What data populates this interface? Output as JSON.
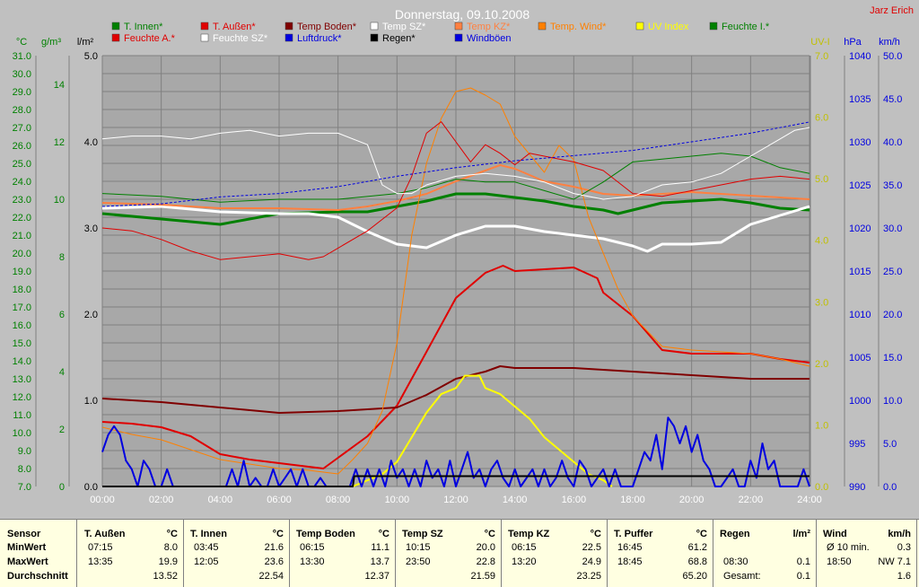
{
  "title": "Donnerstag, 09.10.2008",
  "author": "Jarz Erich",
  "colors": {
    "bg": "#c0c0c0",
    "plot": "#a8a8a8",
    "grid": "#808080",
    "green": "#008000",
    "red": "#e00000",
    "darkred": "#800000",
    "white": "#ffffff",
    "orange": "#ff8040",
    "yellow": "#ffff00",
    "blue": "#0000e0",
    "black": "#000000",
    "panel": "#ffffe1"
  },
  "axis_units": {
    "temp": "°C",
    "hum": "g/m³",
    "rain": "l/m²",
    "uv": "UV-I",
    "press": "hPa",
    "wind": "km/h"
  },
  "chart_data": {
    "type": "line",
    "title": "Donnerstag, 09.10.2008",
    "x_ticks": [
      "00:00",
      "02:00",
      "04:00",
      "06:00",
      "08:00",
      "10:00",
      "12:00",
      "14:00",
      "16:00",
      "18:00",
      "20:00",
      "22:00",
      "24:00"
    ],
    "x_range": [
      0,
      24
    ],
    "axes": {
      "temp": {
        "label": "°C",
        "range": [
          7,
          31
        ],
        "ticks": [
          "7.0",
          "8.0",
          "9.0",
          "10.0",
          "11.0",
          "12.0",
          "13.0",
          "14.0",
          "15.0",
          "16.0",
          "17.0",
          "18.0",
          "19.0",
          "20.0",
          "21.0",
          "22.0",
          "23.0",
          "24.0",
          "25.0",
          "26.0",
          "27.0",
          "28.0",
          "29.0",
          "30.0",
          "31.0"
        ]
      },
      "hum": {
        "label": "g/m³",
        "range": [
          0,
          15
        ],
        "ticks": [
          "0",
          "2",
          "4",
          "6",
          "8",
          "10",
          "12",
          "14"
        ]
      },
      "rain": {
        "label": "l/m²",
        "range": [
          0,
          5
        ],
        "ticks": [
          "0.0",
          "1.0",
          "2.0",
          "3.0",
          "4.0",
          "5.0"
        ]
      },
      "uv": {
        "label": "UV-I",
        "range": [
          0,
          7
        ],
        "ticks": [
          "0.0",
          "1.0",
          "2.0",
          "3.0",
          "4.0",
          "5.0",
          "6.0",
          "7.0"
        ]
      },
      "press": {
        "label": "hPa",
        "range": [
          990,
          1040
        ],
        "ticks": [
          "990",
          "995",
          "1000",
          "1005",
          "1010",
          "1015",
          "1020",
          "1025",
          "1030",
          "1035",
          "1040"
        ]
      },
      "wind": {
        "label": "km/h",
        "range": [
          0,
          50
        ],
        "ticks": [
          "0.0",
          "5.0",
          "10.0",
          "15.0",
          "20.0",
          "25.0",
          "30.0",
          "35.0",
          "40.0",
          "45.0",
          "50.0"
        ]
      }
    },
    "legend": [
      {
        "label": "T. Innen*",
        "color": "#008000"
      },
      {
        "label": "T. Außen*",
        "color": "#e00000"
      },
      {
        "label": "Temp Boden*",
        "color": "#800000"
      },
      {
        "label": "Temp SZ*",
        "color": "#ffffff"
      },
      {
        "label": "Temp KZ*",
        "color": "#ff8040"
      },
      {
        "label": "Temp. Wind*",
        "color": "#ff8000"
      },
      {
        "label": "UV Index",
        "color": "#ffff00"
      },
      {
        "label": "Feuchte I.*",
        "color": "#008000"
      },
      {
        "label": "Feuchte A.*",
        "color": "#e00000"
      },
      {
        "label": "Feuchte SZ*",
        "color": "#ffffff"
      },
      {
        "label": "Luftdruck*",
        "color": "#0000e0"
      },
      {
        "label": "Regen*",
        "color": "#000000"
      },
      {
        "label": "Windböen",
        "color": "#0000e0"
      }
    ],
    "series": [
      {
        "name": "T. Innen*",
        "axis": "temp",
        "color": "#008000",
        "width": 3,
        "x": [
          0,
          2,
          4,
          6,
          8,
          9,
          10,
          11,
          12,
          13,
          14,
          15,
          16,
          17,
          17.5,
          18,
          19,
          20,
          21,
          22,
          23,
          24
        ],
        "y": [
          22.2,
          21.9,
          21.6,
          22.2,
          22.3,
          22.3,
          22.6,
          22.9,
          23.3,
          23.3,
          23.1,
          22.9,
          22.6,
          22.4,
          22.2,
          22.4,
          22.8,
          22.9,
          23.0,
          22.8,
          22.5,
          22.4
        ]
      },
      {
        "name": "T. Außen*",
        "axis": "temp",
        "color": "#e00000",
        "width": 2,
        "x": [
          0,
          1,
          2,
          3,
          4,
          5,
          6,
          7,
          7.5,
          8,
          9,
          10,
          11,
          12,
          13,
          13.6,
          14,
          15,
          16,
          16.8,
          17,
          18,
          19,
          20,
          21,
          22,
          23,
          24
        ],
        "y": [
          10.6,
          10.5,
          10.3,
          9.8,
          8.8,
          8.5,
          8.3,
          8.1,
          8.0,
          8.6,
          9.8,
          11.5,
          14.5,
          17.5,
          18.9,
          19.3,
          19.0,
          19.1,
          19.2,
          18.6,
          17.8,
          16.5,
          14.6,
          14.4,
          14.4,
          14.4,
          14.1,
          13.9
        ]
      },
      {
        "name": "Temp Boden*",
        "axis": "temp",
        "color": "#800000",
        "width": 2,
        "x": [
          0,
          2,
          4,
          6,
          8,
          10,
          11,
          12,
          13,
          13.5,
          14,
          16,
          18,
          20,
          22,
          24
        ],
        "y": [
          11.9,
          11.7,
          11.4,
          11.1,
          11.2,
          11.4,
          12.1,
          13.0,
          13.4,
          13.7,
          13.6,
          13.6,
          13.4,
          13.2,
          13.0,
          13.0
        ]
      },
      {
        "name": "Temp SZ*",
        "axis": "temp",
        "color": "#ffffff",
        "width": 3,
        "x": [
          0,
          2,
          4,
          6,
          7,
          8,
          9,
          10,
          11,
          12,
          13,
          14,
          15,
          16,
          17,
          18,
          18.5,
          19,
          20,
          21,
          22,
          23,
          24
        ],
        "y": [
          22.5,
          22.6,
          22.3,
          22.2,
          22.2,
          22.0,
          21.2,
          20.5,
          20.3,
          21.0,
          21.5,
          21.5,
          21.2,
          21.0,
          20.8,
          20.4,
          20.1,
          20.5,
          20.5,
          20.6,
          21.6,
          22.1,
          22.6
        ]
      },
      {
        "name": "Temp KZ*",
        "axis": "temp",
        "color": "#ff8040",
        "width": 2,
        "x": [
          0,
          2,
          4,
          6,
          8,
          9,
          10,
          11,
          12,
          13,
          13.5,
          14,
          15,
          16,
          17,
          18,
          19,
          20,
          21,
          22,
          23,
          24
        ],
        "y": [
          22.8,
          22.7,
          22.5,
          22.5,
          22.4,
          22.6,
          22.9,
          23.3,
          24.0,
          24.6,
          24.9,
          24.7,
          24.0,
          23.7,
          23.3,
          23.2,
          23.3,
          23.4,
          23.3,
          23.2,
          23.1,
          23.0
        ]
      },
      {
        "name": "Temp. Wind*",
        "axis": "temp",
        "color": "#ff8000",
        "width": 1,
        "x": [
          0,
          1,
          2,
          4,
          6,
          7,
          8,
          8.5,
          9,
          9.5,
          10,
          10.5,
          11,
          11.5,
          12,
          12.5,
          13,
          13.5,
          14,
          14.5,
          15,
          15.5,
          16,
          16.5,
          17,
          17.5,
          18,
          19,
          20,
          21,
          22,
          23,
          24
        ],
        "y": [
          10.3,
          9.9,
          9.6,
          8.5,
          8.0,
          7.9,
          7.7,
          8.5,
          9.4,
          11.2,
          15.0,
          21.0,
          25.0,
          27.5,
          29.0,
          29.2,
          28.8,
          28.3,
          26.5,
          25.5,
          24.5,
          26.0,
          25.2,
          22.0,
          20.0,
          18.0,
          16.5,
          14.8,
          14.6,
          14.5,
          14.4,
          14.1,
          13.7
        ]
      },
      {
        "name": "Feuchte I.*",
        "axis": "hum",
        "color": "#008000",
        "width": 1,
        "x": [
          0,
          2,
          4,
          6,
          8,
          10,
          11,
          12,
          13,
          14,
          15,
          16,
          17,
          18,
          19,
          20,
          21,
          22,
          23,
          24
        ],
        "y": [
          10.2,
          10.1,
          9.9,
          10.0,
          10.0,
          10.2,
          10.4,
          10.7,
          10.6,
          10.6,
          10.3,
          10.0,
          10.6,
          11.3,
          11.4,
          11.5,
          11.6,
          11.5,
          11.1,
          10.9
        ]
      },
      {
        "name": "Feuchte A.*",
        "axis": "hum",
        "color": "#e00000",
        "width": 1,
        "x": [
          0,
          1,
          2,
          3,
          4,
          5,
          6,
          7,
          7.5,
          8,
          9,
          10,
          10.5,
          11,
          11.5,
          12,
          12.5,
          13,
          13.5,
          14,
          14.5,
          15,
          16,
          17,
          18,
          19,
          20,
          21,
          22,
          23,
          24
        ],
        "y": [
          9.0,
          8.9,
          8.6,
          8.2,
          7.9,
          8.0,
          8.1,
          7.9,
          8.0,
          8.3,
          8.9,
          9.7,
          10.8,
          12.3,
          12.7,
          12.0,
          11.3,
          11.9,
          11.6,
          11.2,
          11.6,
          11.5,
          11.3,
          11.0,
          10.2,
          10.1,
          10.3,
          10.5,
          10.7,
          10.8,
          10.7
        ]
      },
      {
        "name": "Feuchte SZ*",
        "axis": "hum",
        "color": "#ffffff",
        "width": 1,
        "x": [
          0,
          1,
          2,
          3,
          4,
          5,
          6,
          7,
          8,
          9,
          9.5,
          10,
          10.5,
          11,
          12,
          13,
          14,
          15,
          16,
          17,
          18,
          19,
          20,
          21,
          22,
          23,
          23.5,
          24
        ],
        "y": [
          12.1,
          12.2,
          12.2,
          12.1,
          12.3,
          12.4,
          12.2,
          12.3,
          12.3,
          11.9,
          10.5,
          10.2,
          10.2,
          10.5,
          10.8,
          10.9,
          10.8,
          10.6,
          10.2,
          10.0,
          10.1,
          10.5,
          10.6,
          10.9,
          11.5,
          12.1,
          12.4,
          12.5
        ]
      },
      {
        "name": "Luftdruck*",
        "axis": "press",
        "color": "#0000e0",
        "width": 1,
        "dash": true,
        "x": [
          0,
          2,
          4,
          6,
          8,
          10,
          12,
          14,
          16,
          18,
          20,
          22,
          24
        ],
        "y": [
          1022.5,
          1022.8,
          1023.6,
          1024.0,
          1024.8,
          1026.0,
          1027.0,
          1027.8,
          1028.4,
          1029.0,
          1030.0,
          1031.0,
          1032.3
        ]
      },
      {
        "name": "UV Index",
        "axis": "uv",
        "color": "#ffff00",
        "width": 2,
        "x": [
          8.5,
          9,
          9.5,
          10,
          10.5,
          11,
          11.5,
          12,
          12.3,
          12.5,
          12.8,
          13,
          13.5,
          14,
          14.5,
          15,
          15.5,
          16,
          16.5,
          17,
          17.3
        ],
        "y": [
          0.0,
          0.1,
          0.2,
          0.4,
          0.8,
          1.2,
          1.5,
          1.6,
          1.8,
          1.8,
          1.8,
          1.6,
          1.5,
          1.3,
          1.1,
          0.8,
          0.6,
          0.4,
          0.2,
          0.1,
          0.0
        ]
      },
      {
        "name": "Windböen",
        "axis": "wind",
        "color": "#0000e0",
        "width": 2,
        "x": [
          0,
          0.2,
          0.4,
          0.6,
          0.8,
          1.0,
          1.2,
          1.4,
          1.6,
          1.8,
          2.0,
          2.2,
          2.4,
          2.6,
          2.8,
          3.0,
          3.2,
          3.4,
          3.6,
          3.8,
          4.0,
          4.2,
          4.4,
          4.6,
          4.8,
          5.0,
          5.2,
          5.4,
          5.6,
          5.8,
          6.0,
          6.2,
          6.4,
          6.6,
          6.8,
          7.0,
          7.2,
          7.4,
          7.6,
          7.8,
          8.0,
          8.2,
          8.4,
          8.6,
          8.8,
          9.0,
          9.2,
          9.4,
          9.6,
          9.8,
          10.0,
          10.2,
          10.4,
          10.6,
          10.8,
          11.0,
          11.2,
          11.4,
          11.6,
          11.8,
          12.0,
          12.2,
          12.4,
          12.6,
          12.8,
          13.0,
          13.2,
          13.4,
          13.6,
          13.8,
          14.0,
          14.2,
          14.4,
          14.6,
          14.8,
          15.0,
          15.2,
          15.4,
          15.6,
          15.8,
          16.0,
          16.2,
          16.4,
          16.6,
          16.8,
          17.0,
          17.2,
          17.4,
          17.6,
          17.8,
          18.0,
          18.2,
          18.4,
          18.6,
          18.8,
          19.0,
          19.2,
          19.4,
          19.6,
          19.8,
          20.0,
          20.2,
          20.4,
          20.6,
          20.8,
          21.0,
          21.2,
          21.4,
          21.6,
          21.8,
          22.0,
          22.2,
          22.4,
          22.6,
          22.8,
          23.0,
          23.2,
          23.4,
          23.6,
          23.8,
          24.0
        ],
        "y": [
          4,
          6,
          7,
          6,
          3,
          2,
          0,
          3,
          2,
          0,
          0,
          2,
          0,
          0,
          0,
          0,
          0,
          0,
          0,
          0,
          0,
          0,
          2,
          0,
          3,
          0,
          1,
          0,
          0,
          2,
          0,
          1,
          2,
          0,
          2,
          0,
          0,
          1,
          0,
          0,
          0,
          0,
          0,
          2,
          0,
          2,
          0,
          2,
          0,
          3,
          1,
          2,
          0,
          2,
          0,
          3,
          1,
          2,
          0,
          3,
          0,
          2,
          4,
          1,
          2,
          0,
          2,
          3,
          1,
          0,
          2,
          0,
          1,
          2,
          0,
          2,
          0,
          1,
          3,
          1,
          0,
          3,
          2,
          0,
          1,
          2,
          0,
          2,
          0,
          0,
          0,
          2,
          4,
          3,
          6,
          2,
          8,
          7,
          5,
          7,
          4,
          6,
          3,
          2,
          0,
          0,
          1,
          2,
          0,
          0,
          3,
          1,
          5,
          2,
          3,
          0,
          0,
          0,
          0,
          2,
          0
        ]
      },
      {
        "name": "Regen*",
        "axis": "rain",
        "color": "#000000",
        "width": 2,
        "x": [
          0,
          8.5,
          8.55,
          24
        ],
        "y": [
          0,
          0,
          0.12,
          0.12
        ]
      }
    ]
  },
  "table": [
    {
      "title": "Sensor",
      "unit": "",
      "rows": [
        [
          "MinWert",
          "",
          ""
        ],
        [
          "MaxWert",
          "",
          ""
        ],
        [
          "Durchschnitt",
          "",
          ""
        ]
      ],
      "is_label": true
    },
    {
      "title": "T. Außen",
      "unit": "°C",
      "rows": [
        [
          "07:15",
          "8.0"
        ],
        [
          "13:35",
          "19.9"
        ],
        [
          "",
          "13.52"
        ]
      ]
    },
    {
      "title": "T. Innen",
      "unit": "°C",
      "rows": [
        [
          "03:45",
          "21.6"
        ],
        [
          "12:05",
          "23.6"
        ],
        [
          "",
          "22.54"
        ]
      ]
    },
    {
      "title": "Temp Boden",
      "unit": "°C",
      "rows": [
        [
          "06:15",
          "11.1"
        ],
        [
          "13:30",
          "13.7"
        ],
        [
          "",
          "12.37"
        ]
      ]
    },
    {
      "title": "Temp SZ",
      "unit": "°C",
      "rows": [
        [
          "10:15",
          "20.0"
        ],
        [
          "23:50",
          "22.8"
        ],
        [
          "",
          "21.59"
        ]
      ]
    },
    {
      "title": "Temp KZ",
      "unit": "°C",
      "rows": [
        [
          "06:15",
          "22.5"
        ],
        [
          "13:20",
          "24.9"
        ],
        [
          "",
          "23.25"
        ]
      ]
    },
    {
      "title": "T. Puffer",
      "unit": "°C",
      "rows": [
        [
          "16:45",
          "61.2"
        ],
        [
          "18:45",
          "68.8"
        ],
        [
          "",
          "65.20"
        ]
      ]
    },
    {
      "title": "Regen",
      "unit": "l/m²",
      "rows": [
        [
          "",
          ""
        ],
        [
          "08:30",
          "0.1"
        ],
        [
          "Gesamt:",
          "0.1"
        ]
      ]
    },
    {
      "title": "Wind",
      "unit": "km/h",
      "rows": [
        [
          "Ø 10 min.",
          "0.3"
        ],
        [
          "18:50",
          "NW 7.1"
        ],
        [
          "",
          "1.6"
        ]
      ]
    }
  ]
}
